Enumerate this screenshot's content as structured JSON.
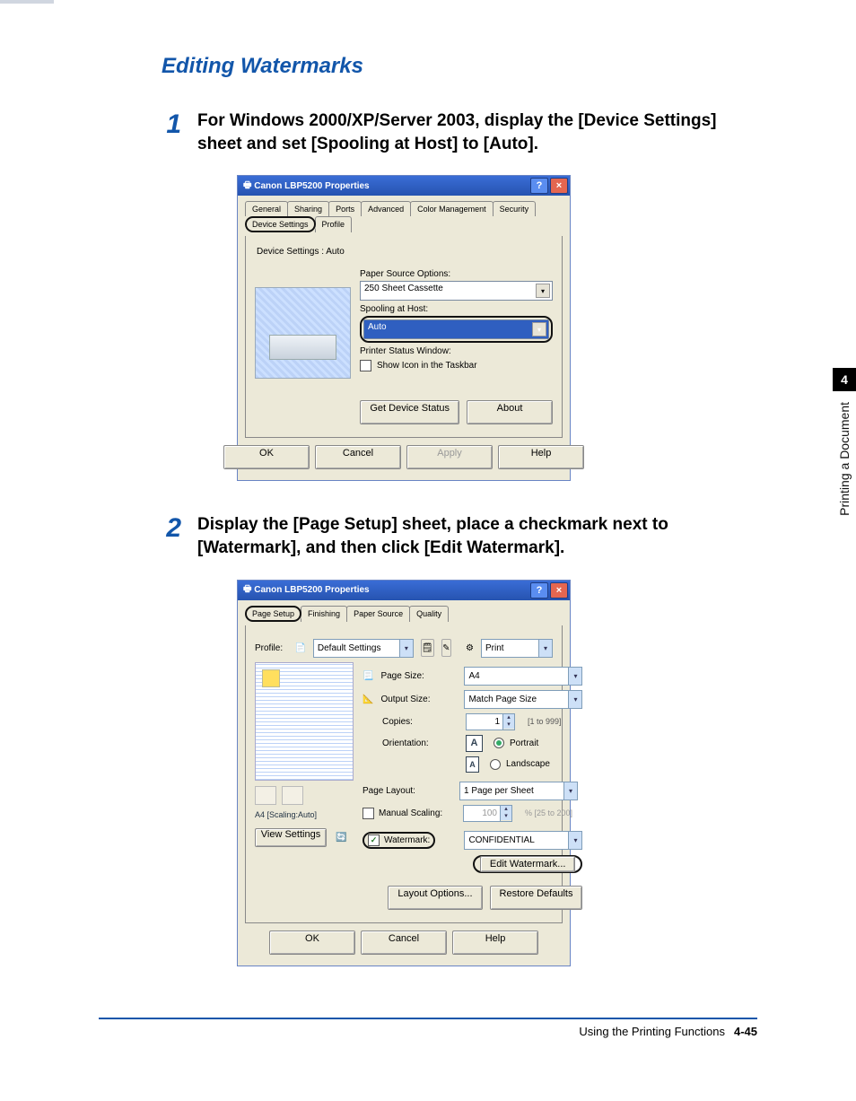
{
  "heading": "Editing Watermarks",
  "step1": {
    "num": "1",
    "text": "For Windows 2000/XP/Server 2003, display the [Device Settings] sheet and set [Spooling at Host] to [Auto]."
  },
  "step2": {
    "num": "2",
    "text": "Display the [Page Setup] sheet, place a checkmark next to [Watermark], and then click [Edit Watermark]."
  },
  "win1": {
    "title": "Canon LBP5200 Properties",
    "tabs": [
      "General",
      "Sharing",
      "Ports",
      "Advanced",
      "Color Management",
      "Security",
      "Device Settings",
      "Profile"
    ],
    "status": "Device Settings : Auto",
    "f1_label": "Paper Source Options:",
    "f1_value": "250 Sheet Cassette",
    "f2_label": "Spooling at Host:",
    "f2_value": "Auto",
    "f3_label": "Printer Status Window:",
    "chk_label": "Show Icon in the Taskbar",
    "btn_gds": "Get Device Status",
    "btn_about": "About",
    "ok": "OK",
    "cancel": "Cancel",
    "apply": "Apply",
    "help": "Help"
  },
  "win2": {
    "title": "Canon LBP5200 Properties",
    "tabs": [
      "Page Setup",
      "Finishing",
      "Paper Source",
      "Quality"
    ],
    "profile_label": "Profile:",
    "profile_value": "Default Settings",
    "output_method_label": "Print",
    "rows": {
      "page_size": {
        "l": "Page Size:",
        "v": "A4"
      },
      "output_size": {
        "l": "Output Size:",
        "v": "Match Page Size"
      },
      "copies": {
        "l": "Copies:",
        "v": "1",
        "hint": "[1 to 999]"
      },
      "orientation": {
        "l": "Orientation:",
        "portrait": "Portrait",
        "landscape": "Landscape"
      },
      "page_layout": {
        "l": "Page Layout:",
        "v": "1 Page per Sheet"
      },
      "manual": {
        "l": "Manual Scaling:",
        "v": "100",
        "hint": "%  [25 to 200]"
      },
      "watermark": {
        "l": "Watermark:",
        "v": "CONFIDENTIAL"
      }
    },
    "preview_status": "A4 [Scaling:Auto]",
    "btn_view": "View Settings",
    "btn_edit": "Edit Watermark...",
    "btn_layout": "Layout Options...",
    "btn_restore": "Restore Defaults",
    "ok": "OK",
    "cancel": "Cancel",
    "help": "Help"
  },
  "side": {
    "num": "4",
    "label": "Printing a Document"
  },
  "footer": {
    "section": "Using the Printing Functions",
    "page": "4-45"
  }
}
